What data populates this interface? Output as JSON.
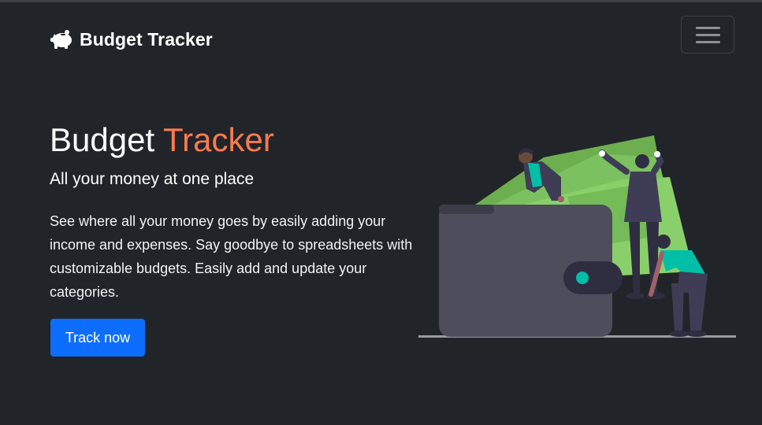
{
  "navbar": {
    "brand_icon": "piggy-bank-icon",
    "brand_text": "Budget Tracker",
    "menu_icon": "hamburger-menu-icon"
  },
  "hero": {
    "title_main": "Budget",
    "title_accent": "Tracker",
    "subtitle": "All your money at one place",
    "description": "See where all your money goes by easily adding your income and expenses. Say goodbye to spreadsheets with customizable budgets. Easily add and update your categories.",
    "cta_label": "Track now"
  },
  "colors": {
    "background": "#212529",
    "accent": "#fd7a4f",
    "primary_button": "#0d6efd",
    "money_green": "#7cc15f",
    "wallet": "#4e4d5c",
    "teal": "#00bfa6"
  },
  "illustration": {
    "icon": "wallet-with-money-people-illustration"
  }
}
